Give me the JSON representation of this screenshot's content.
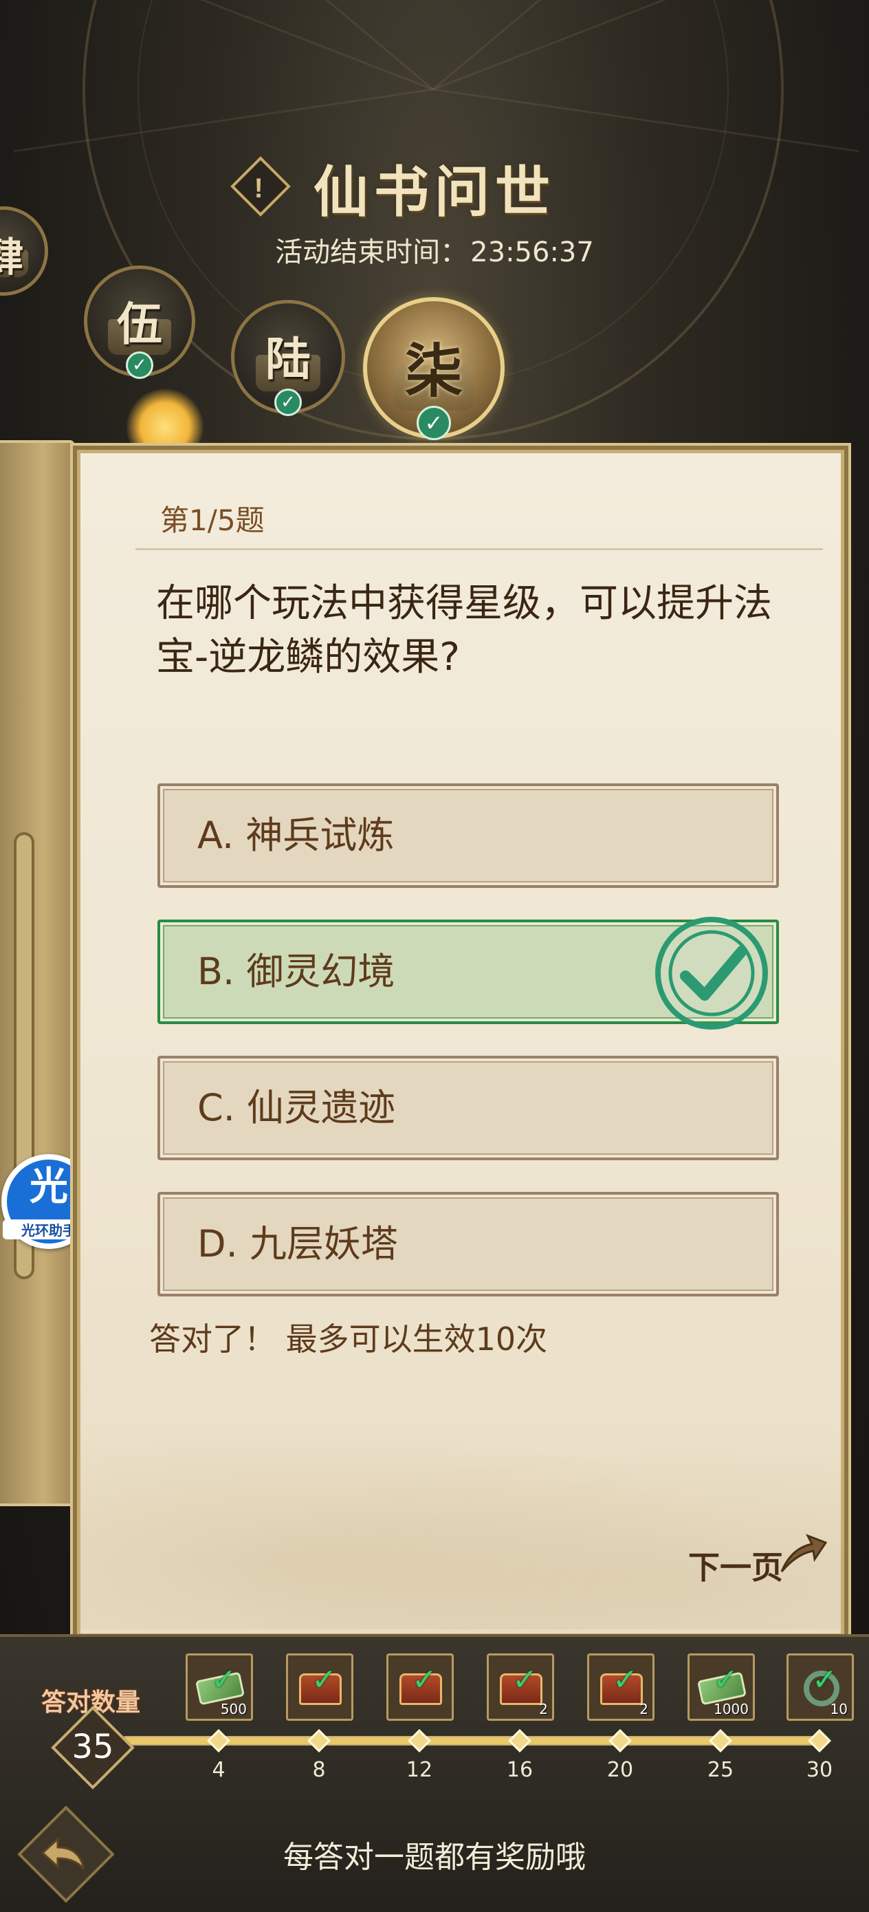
{
  "header": {
    "title": "仙书问世",
    "info_icon": "!",
    "timer_label": "活动结束时间：",
    "timer_value": "23:56:37"
  },
  "chapters": [
    {
      "char": "肆",
      "completed": true
    },
    {
      "char": "伍",
      "completed": true
    },
    {
      "char": "陆",
      "completed": true
    },
    {
      "char": "柒",
      "completed": true,
      "active": true
    }
  ],
  "quiz": {
    "question_number": "第1/5题",
    "question_text": "在哪个玩法中获得星级，可以提升法宝-逆龙鳞的效果?",
    "options": [
      {
        "label": "A. 神兵试炼",
        "correct": false
      },
      {
        "label": "B. 御灵幻境",
        "correct": true
      },
      {
        "label": "C. 仙灵遗迹",
        "correct": false
      },
      {
        "label": "D. 九层妖塔",
        "correct": false
      }
    ],
    "feedback": "答对了！ 最多可以生效10次",
    "next_label": "下一页"
  },
  "helper": {
    "big": "光",
    "small": "光环助手"
  },
  "progress": {
    "label": "答对数量",
    "count": "35",
    "fill_fraction": 1.0,
    "milestones": [
      "4",
      "8",
      "12",
      "16",
      "20",
      "25",
      "30"
    ],
    "rewards": [
      {
        "type": "money",
        "qty": "500",
        "claimed": true
      },
      {
        "type": "chest",
        "qty": "",
        "claimed": true
      },
      {
        "type": "chest",
        "qty": "",
        "claimed": true
      },
      {
        "type": "chest",
        "qty": "2",
        "claimed": true
      },
      {
        "type": "chest",
        "qty": "2",
        "claimed": true
      },
      {
        "type": "money",
        "qty": "1000",
        "claimed": true
      },
      {
        "type": "gem",
        "qty": "10",
        "claimed": true
      }
    ]
  },
  "footer": {
    "tip": "每答对一题都有奖励哦"
  },
  "colors": {
    "correct_green": "#2b9a72",
    "gold": "#c8ad70",
    "paper": "#efe6d2"
  },
  "icons": {
    "back": "back-arrow-icon",
    "next": "next-arrow-icon",
    "info": "info-icon",
    "check": "check-icon"
  }
}
